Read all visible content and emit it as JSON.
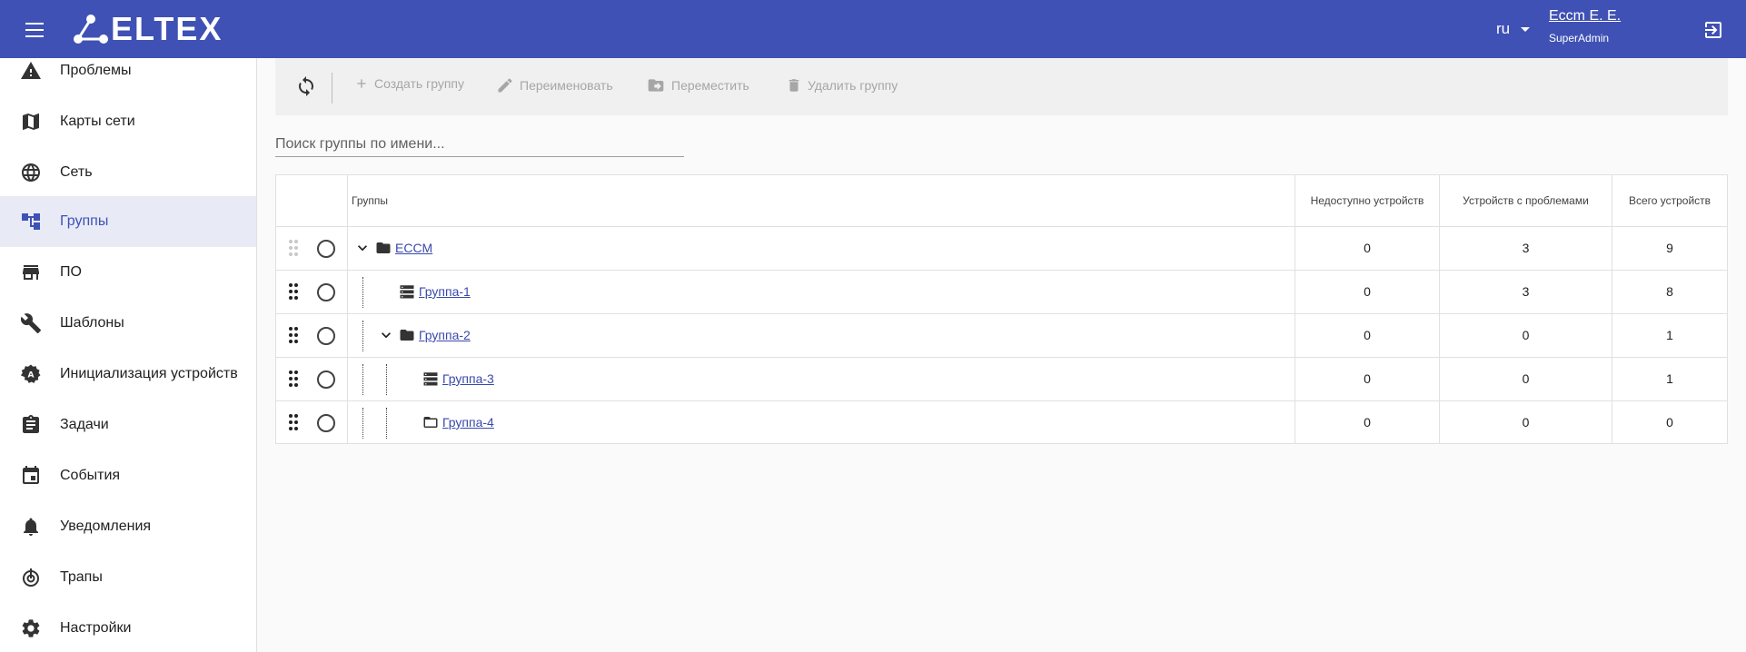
{
  "header": {
    "logo_text": "ELTEX",
    "language": "ru",
    "user_name": "Eccm E. E.",
    "user_role": "SuperAdmin",
    "bg_color": "#3f51b5"
  },
  "sidebar": {
    "items": [
      {
        "label": "Проблемы",
        "icon": "warning-icon"
      },
      {
        "label": "Карты сети",
        "icon": "map-icon"
      },
      {
        "label": "Сеть",
        "icon": "globe-icon"
      },
      {
        "label": "Группы",
        "icon": "groups-tree-icon",
        "active": true
      },
      {
        "label": "ПО",
        "icon": "store-icon"
      },
      {
        "label": "Шаблоны",
        "icon": "wrench-icon"
      },
      {
        "label": "Инициализация устройств",
        "icon": "init-gear-icon"
      },
      {
        "label": "Задачи",
        "icon": "clipboard-icon"
      },
      {
        "label": "События",
        "icon": "calendar-icon"
      },
      {
        "label": "Уведомления",
        "icon": "bell-icon"
      },
      {
        "label": "Трапы",
        "icon": "trap-icon"
      },
      {
        "label": "Настройки",
        "icon": "settings-icon"
      }
    ]
  },
  "toolbar": {
    "create": "Создать группу",
    "rename": "Переименовать",
    "move": "Переместить",
    "delete": "Удалить группу"
  },
  "search": {
    "placeholder": "Поиск группы по имени..."
  },
  "table": {
    "columns": {
      "groups": "Группы",
      "unavailable": "Недоступно устройств",
      "problems": "Устройств с проблемами",
      "total": "Всего устройств"
    },
    "rows": [
      {
        "name": "ECCM",
        "level": 0,
        "icon": "folder-filled-icon",
        "expandable": true,
        "unavailable": "0",
        "problems": "3",
        "total": "9"
      },
      {
        "name": "Группа-1",
        "level": 1,
        "icon": "device-list-icon",
        "expandable": false,
        "unavailable": "0",
        "problems": "3",
        "total": "8"
      },
      {
        "name": "Группа-2",
        "level": 1,
        "icon": "folder-filled-icon",
        "expandable": true,
        "unavailable": "0",
        "problems": "0",
        "total": "1"
      },
      {
        "name": "Группа-3",
        "level": 2,
        "icon": "device-list-icon",
        "expandable": false,
        "unavailable": "0",
        "problems": "0",
        "total": "1"
      },
      {
        "name": "Группа-4",
        "level": 2,
        "icon": "folder-outline-icon",
        "expandable": false,
        "unavailable": "0",
        "problems": "0",
        "total": "0"
      }
    ]
  }
}
